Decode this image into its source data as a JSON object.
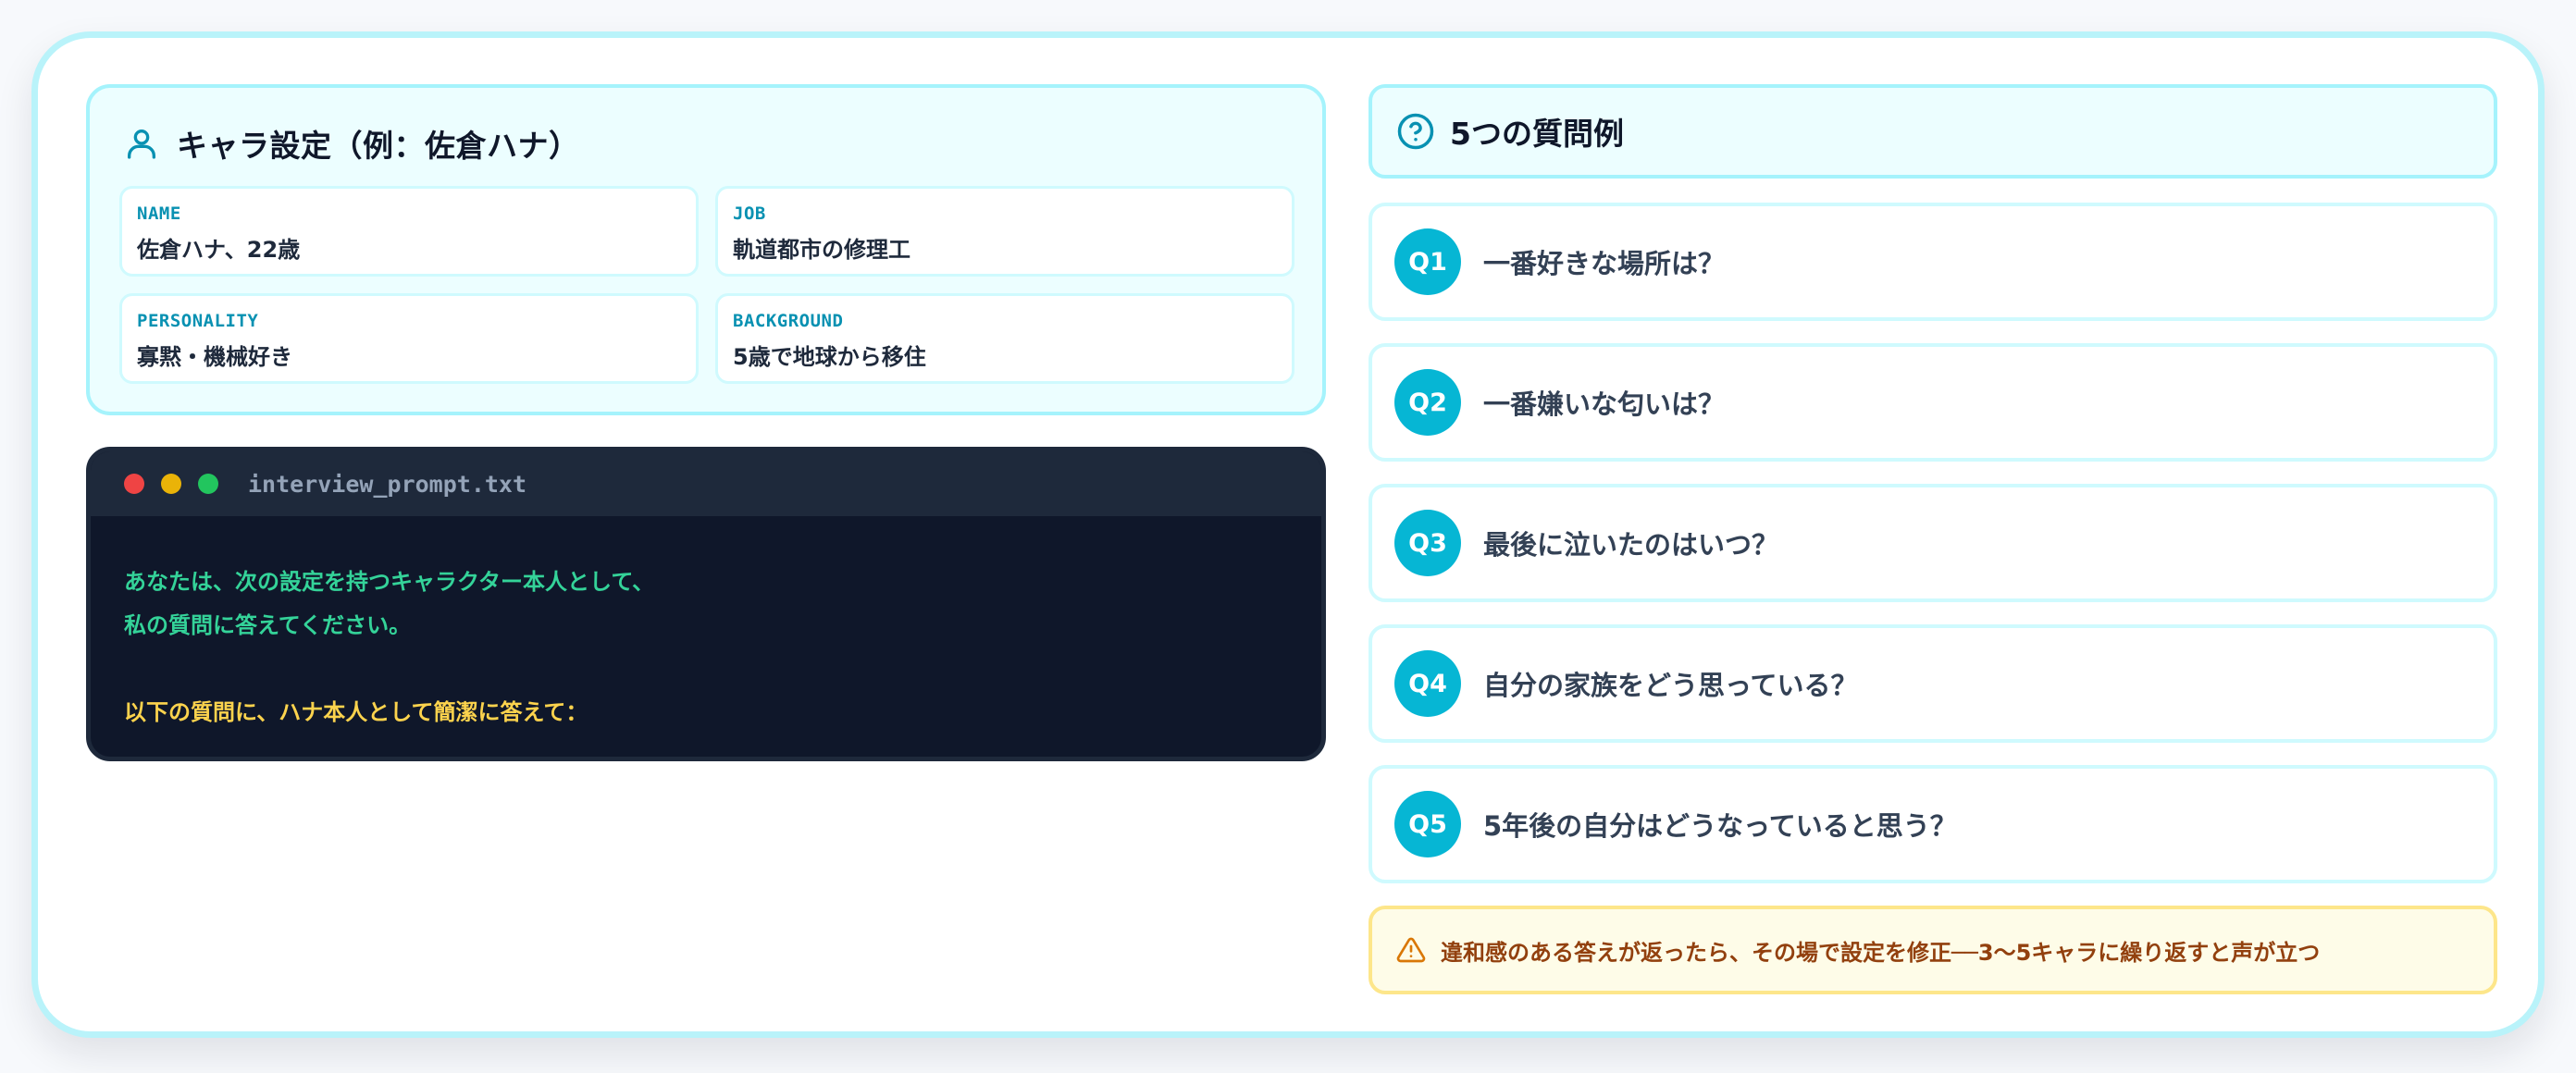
{
  "character": {
    "title": "キャラ設定（例：佐倉ハナ）",
    "icon": "user-icon",
    "fields": [
      {
        "label": "NAME",
        "value": "佐倉ハナ、22歳"
      },
      {
        "label": "JOB",
        "value": "軌道都市の修理工"
      },
      {
        "label": "PERSONALITY",
        "value": "寡黙・機械好き"
      },
      {
        "label": "BACKGROUND",
        "value": "5歳で地球から移住"
      }
    ]
  },
  "terminal": {
    "filename": "interview_prompt.txt",
    "lines": [
      "あなたは、次の設定を持つキャラクター本人として、",
      "私の質問に答えてください。",
      "以下の質問に、ハナ本人として簡潔に答えて："
    ],
    "colors": {
      "text_green": "#34d399",
      "text_yellow": "#fcd34d"
    }
  },
  "questions": {
    "title": "5つの質問例",
    "icon": "question-circle-icon",
    "items": [
      {
        "badge": "Q1",
        "text": "一番好きな場所は？"
      },
      {
        "badge": "Q2",
        "text": "一番嫌いな匂いは？"
      },
      {
        "badge": "Q3",
        "text": "最後に泣いたのはいつ？"
      },
      {
        "badge": "Q4",
        "text": "自分の家族をどう思っている？"
      },
      {
        "badge": "Q5",
        "text": "5年後の自分はどうなっていると思う？"
      }
    ]
  },
  "note": {
    "icon": "warning-icon",
    "text": "違和感のある答えが返ったら、その場で設定を修正──3〜5キャラに繰り返すと声が立つ"
  },
  "colors": {
    "accent": "#06b6d4",
    "accent_dark": "#0891b2",
    "frame_border": "#b9f3fa",
    "card_bg": "#ecfeff",
    "note_bg": "#fefce8"
  }
}
